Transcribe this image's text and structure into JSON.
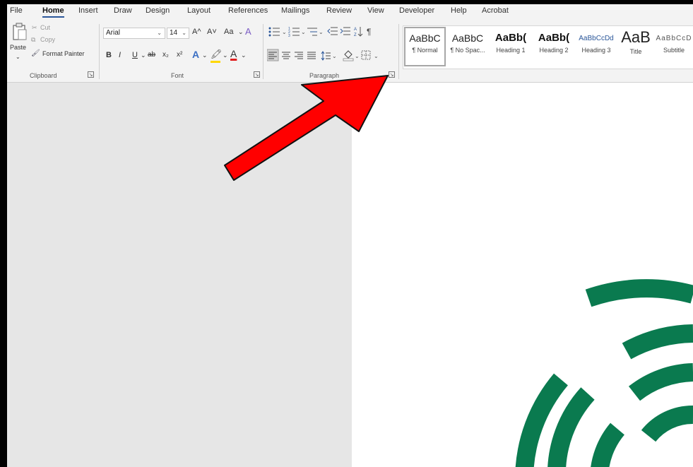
{
  "menu": {
    "tabs": [
      "File",
      "Home",
      "Insert",
      "Draw",
      "Design",
      "Layout",
      "References",
      "Mailings",
      "Review",
      "View",
      "Developer",
      "Help",
      "Acrobat"
    ],
    "active": "Home"
  },
  "clipboard": {
    "paste": "Paste",
    "cut": "Cut",
    "copy": "Copy",
    "format_painter": "Format Painter",
    "group": "Clipboard"
  },
  "font": {
    "name": "Arial",
    "size": "14",
    "group": "Font",
    "grow": "A^",
    "shrink": "A˅",
    "case": "Aa",
    "bold": "B",
    "italic": "I",
    "underline": "U",
    "strike": "ab",
    "subscript": "x₂",
    "superscript": "x²"
  },
  "paragraph": {
    "group": "Paragraph",
    "pilcrow": "¶"
  },
  "styles": {
    "items": [
      {
        "preview": "AaBbC",
        "label": "¶ Normal"
      },
      {
        "preview": "AaBbC",
        "label": "¶ No Spac..."
      },
      {
        "preview": "AaBb(",
        "label": "Heading 1"
      },
      {
        "preview": "AaBb(",
        "label": "Heading 2"
      },
      {
        "preview": "AaBbCcDd",
        "label": "Heading 3"
      },
      {
        "preview": "AaB",
        "label": "Title"
      },
      {
        "preview": "AaBbCcD",
        "label": "Subtitle"
      }
    ]
  },
  "colors": {
    "accent": "#2b579a",
    "logo_green": "#0a7a4f",
    "arrow": "#ff0000",
    "highlight": "#ffd800",
    "font_red": "#e02020"
  }
}
